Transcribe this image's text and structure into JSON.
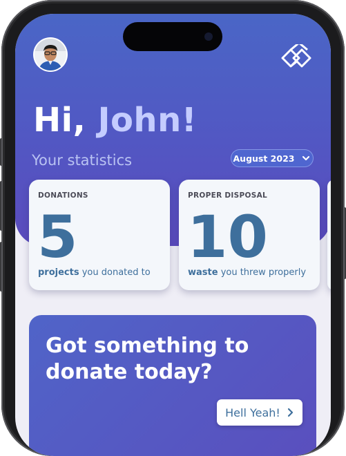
{
  "header": {
    "greeting_prefix": "Hi, ",
    "user_name": "John!",
    "section_label": "Your statistics",
    "month_selector": "August 2023"
  },
  "cards": [
    {
      "title": "DONATIONS",
      "value": "5",
      "desc_bold": "projects",
      "desc_rest": " you donated to"
    },
    {
      "title": "PROPER DISPOSAL",
      "value": "10",
      "desc_bold": "waste",
      "desc_rest": " you threw properly"
    }
  ],
  "promo": {
    "text": "Got something to donate today?",
    "button_label": "Hell Yeah!"
  },
  "colors": {
    "brand_gradient_top": "#4a66c6",
    "brand_gradient_bottom": "#5b4bbd",
    "accent_text": "#3e6f9c",
    "name_highlight": "#c4ccff"
  },
  "icons": [
    "avatar",
    "app-logo-icon",
    "chevron-down-icon",
    "chevron-right-icon"
  ]
}
